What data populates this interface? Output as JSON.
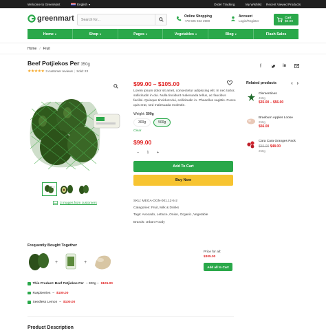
{
  "topbar": {
    "welcome": "Welcome to GreenMart",
    "language": "English",
    "links": [
      "Order Tracking",
      "My Wishlist",
      "Recent Viewed Products"
    ]
  },
  "header": {
    "logo": "greenmart",
    "search_placeholder": "Search for...",
    "phone_title": "Online Shopping",
    "phone_number": "+78 925 942 2900",
    "account_title": "Account",
    "account_sub": "Login/Register",
    "cart_label": "Cart",
    "cart_total": "$0.00",
    "cart_count": "0"
  },
  "nav": [
    "Home",
    "Shop",
    "Pages",
    "Vegetables",
    "Blog",
    "Flash Sales"
  ],
  "breadcrumb": [
    "Home",
    "Fruit"
  ],
  "product": {
    "title": "Beef Potjiekos Per",
    "weight": "350g",
    "reviews": "3 customer reviews",
    "sold": "Sold: 23",
    "price_range": "$99.00 – $105.00",
    "description": "Lorem ipsum dolor sit amet, consectetur adipiscing elit. In nec tortor, sollicitudin in dui. Nulla tincidunt malesuada tellus, ac faucibus facilisi. Quisque tincidunt dui, sollicitudin in. Phasellus sagittis. Fusce quis erat, sed malesuada molestie.",
    "weight_label": "Weight:",
    "weight_selected": "500g",
    "weight_options": [
      "300g",
      "500g"
    ],
    "clear_label": "Clear",
    "price": "$99.00",
    "quantity": "1",
    "add_to_cart": "Add To Cart",
    "buy_now": "Buy Now",
    "images_from_customers": "3 images from customers",
    "sku": "SKU: MEGA-OGN-001.12-5-2",
    "categories": "Categories: Fruit, Milk & Drinks",
    "tags": "Tags: Avocado, Lettuce, Onion, Organic, Vegetable",
    "brands": "Brands: Urban Foody"
  },
  "related": {
    "title": "Related products",
    "items": [
      {
        "name": "Clementines",
        "weight": "450g",
        "old_price": "",
        "price": "$35.00 – $56.00"
      },
      {
        "name": "Braeburn Apples Loose",
        "weight": "250g",
        "old_price": "",
        "price": "$56.00"
      },
      {
        "name": "Cara Cara Oranges Pack",
        "weight": "250g",
        "old_price": "$55.00",
        "price": "$48.00"
      }
    ]
  },
  "fbt": {
    "title": "Frequently Bought Together",
    "price_for_all_label": "Price for all:",
    "price_for_all": "$305.00",
    "add_all_label": "Add all to Cart",
    "items": [
      {
        "name": "This Product: Beef Potjiekos Per",
        "detail": " – 300g – ",
        "price": "$105.00"
      },
      {
        "name": "Raspberries",
        "detail": " – ",
        "price": "$100.00"
      },
      {
        "name": "Seedless Lemon",
        "detail": " – ",
        "price": "$100.00"
      }
    ]
  },
  "product_description_title": "Product Description",
  "colors": {
    "accent": "#2aa84a",
    "price": "#e02020",
    "buy": "#f7c431",
    "star": "#f5a623"
  }
}
